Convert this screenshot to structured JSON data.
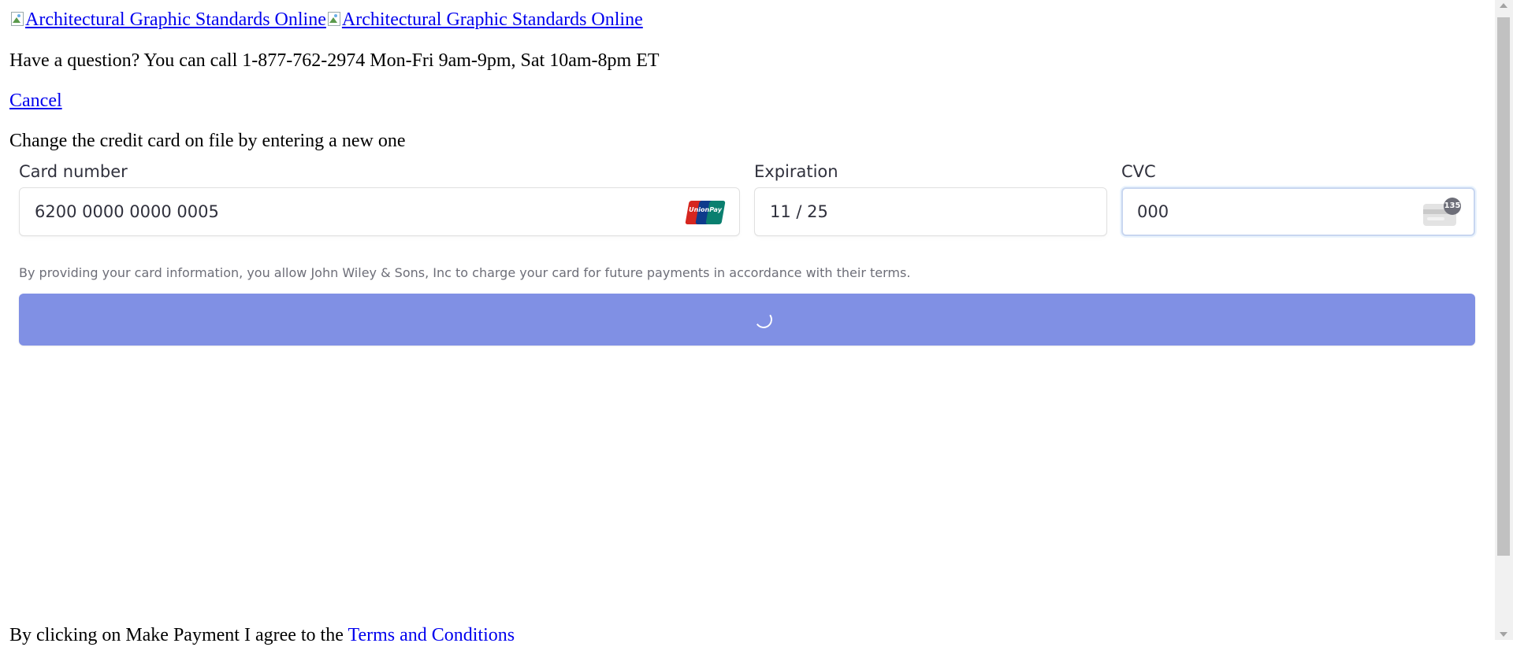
{
  "header": {
    "logo_alt_1": "Architectural Graphic Standards Online",
    "logo_alt_2": "Architectural Graphic Standards Online"
  },
  "contact": {
    "text": "Have a question? You can call 1-877-762-2974 Mon-Fri 9am-9pm, Sat 10am-8pm ET"
  },
  "cancel_label": "Cancel",
  "instructions": "Change the credit card on file by entering a new one",
  "card_form": {
    "card_number": {
      "label": "Card number",
      "value": "6200 0000 0000 0005",
      "brand": "UnionPay",
      "brand_icon": "unionpay-icon"
    },
    "expiration": {
      "label": "Expiration",
      "value": "11 / 25"
    },
    "cvc": {
      "label": "CVC",
      "value": "000",
      "badge": "135",
      "icon": "cvc-card-icon"
    },
    "consent": "By providing your card information, you allow John Wiley & Sons, Inc to charge your card for future payments in accordance with their terms.",
    "submit_state": "loading",
    "button_color": "#8090e4"
  },
  "footer": {
    "agree_prefix": "By clicking on Make Payment I agree to the ",
    "terms_link": "Terms and Conditions"
  },
  "colors": {
    "link": "#0000ee",
    "label": "#30313d",
    "muted": "#6d6e78"
  }
}
